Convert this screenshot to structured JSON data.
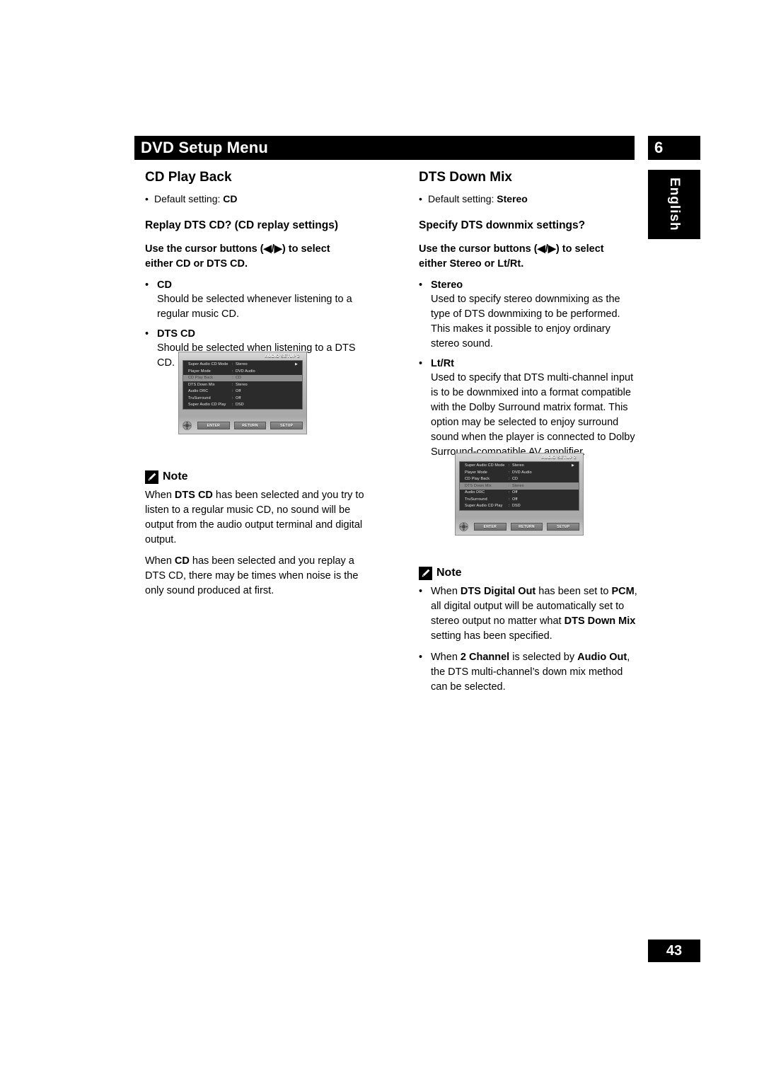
{
  "header": {
    "title": "DVD Setup Menu",
    "chapter": "6",
    "language_tab": "English"
  },
  "page_number": "43",
  "left_column": {
    "section_title": "CD Play Back",
    "default_setting_prefix": "Default setting: ",
    "default_setting_value": "CD",
    "sub_title": "Replay DTS CD? (CD replay settings)",
    "lead_line1": "Use the cursor buttons (◀/▶) to select",
    "lead_line2_pre": "either ",
    "lead_line2_bold1": "CD",
    "lead_line2_mid": " or ",
    "lead_line2_bold2": "DTS CD",
    "lead_line2_post": ".",
    "options": [
      {
        "name": "CD",
        "description": "Should be selected whenever listening to a regular music CD."
      },
      {
        "name": "DTS CD",
        "description": "Should be selected when listening to a DTS CD."
      }
    ],
    "note": {
      "label": "Note",
      "paragraphs": [
        {
          "p1": "When ",
          "b1": "DTS CD",
          "p2": " has been selected and you try to listen to a regular music CD, no sound will be output from the audio output terminal and digital output."
        },
        {
          "p1": "When ",
          "b1": "CD",
          "p2": " has been selected and you replay a DTS CD, there may be times when noise is the only sound produced at first."
        }
      ]
    },
    "tv_screen": {
      "title": "AUDIO SETUP 2",
      "rows": [
        {
          "label": "Super Audio CD Mode",
          "value": "Stereo",
          "selected": false,
          "arrow": "▶"
        },
        {
          "label": "Player Mode",
          "value": "DVD Audio",
          "selected": false,
          "arrow": ""
        },
        {
          "label": "CD Play Back",
          "value": "CD",
          "selected": true,
          "arrow": ""
        },
        {
          "label": "DTS Down Mix",
          "value": "Stereo",
          "selected": false,
          "arrow": ""
        },
        {
          "label": "Audio DRC",
          "value": "Off",
          "selected": false,
          "arrow": ""
        },
        {
          "label": "TruSurround",
          "value": "Off",
          "selected": false,
          "arrow": ""
        },
        {
          "label": "Super Audio CD Play",
          "value": "DSD",
          "selected": false,
          "arrow": ""
        }
      ],
      "buttons": [
        "ENTER",
        "RETURN",
        "SETUP"
      ]
    }
  },
  "right_column": {
    "section_title": "DTS Down Mix",
    "default_setting_prefix": "Default setting: ",
    "default_setting_value": "Stereo",
    "sub_title": "Specify DTS downmix settings?",
    "lead_line1": "Use the cursor buttons (◀/▶) to select",
    "lead_line2_pre": "either ",
    "lead_line2_bold1": "Stereo",
    "lead_line2_mid": " or ",
    "lead_line2_bold2": "Lt/Rt",
    "lead_line2_post": ".",
    "options": [
      {
        "name": "Stereo",
        "description": "Used to specify stereo downmixing as the type of DTS downmixing to be performed. This makes it possible to enjoy ordinary stereo sound."
      },
      {
        "name": "Lt/Rt",
        "description": "Used to specify that DTS multi-channel input is to be downmixed into a format compatible with the Dolby Surround matrix format. This option may be selected to enjoy surround sound when the player is connected to Dolby Surround-compatible AV amplifier."
      }
    ],
    "note": {
      "label": "Note",
      "bullets": [
        {
          "p1": "When ",
          "b1": "DTS Digital Out",
          "p2": " has been set to ",
          "b2": "PCM",
          "p3": ", all digital output will be automatically set to stereo output no matter what ",
          "b3": "DTS Down Mix",
          "p4": " setting has been specified."
        },
        {
          "p1": "When ",
          "b1": "2 Channel",
          "p2": " is selected by ",
          "b2": "Audio Out",
          "p3": ", the DTS multi-channel’s down mix method can be selected."
        }
      ]
    },
    "tv_screen": {
      "title": "AUDIO SETUP 2",
      "rows": [
        {
          "label": "Super Audio CD Mode",
          "value": "Stereo",
          "selected": false,
          "arrow": "▶"
        },
        {
          "label": "Player Mode",
          "value": "DVD Audio",
          "selected": false,
          "arrow": ""
        },
        {
          "label": "CD Play Back",
          "value": "CD",
          "selected": false,
          "arrow": ""
        },
        {
          "label": "DTS Down Mix",
          "value": "Stereo",
          "selected": true,
          "arrow": ""
        },
        {
          "label": "Audio DRC",
          "value": "Off",
          "selected": false,
          "arrow": ""
        },
        {
          "label": "TruSurround",
          "value": "Off",
          "selected": false,
          "arrow": ""
        },
        {
          "label": "Super Audio CD Play",
          "value": "DSD",
          "selected": false,
          "arrow": ""
        }
      ],
      "buttons": [
        "ENTER",
        "RETURN",
        "SETUP"
      ]
    }
  }
}
